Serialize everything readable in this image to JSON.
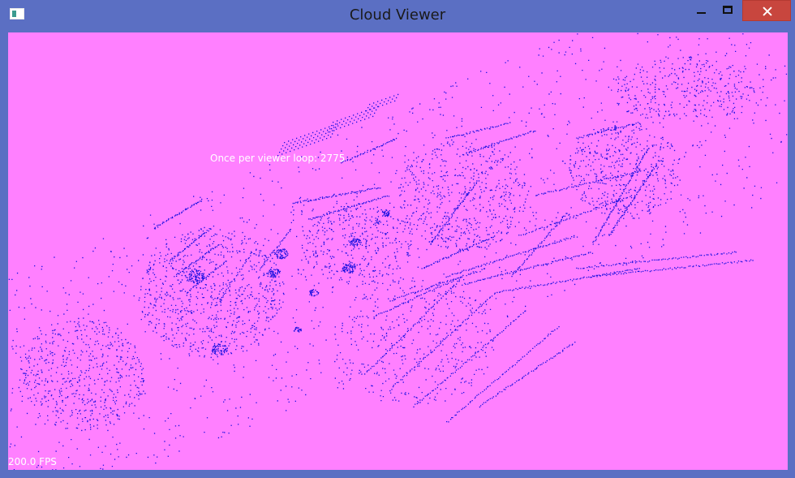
{
  "window": {
    "title": "Cloud Viewer",
    "buttons": {
      "minimize": "minimize",
      "maximize": "maximize",
      "close": "close"
    }
  },
  "viewer": {
    "background_color": "#ff80ff",
    "point_color": "#1a10e0",
    "loop_text": "Once per viewer loop: 2775",
    "fps_text": "200.0 FPS"
  }
}
